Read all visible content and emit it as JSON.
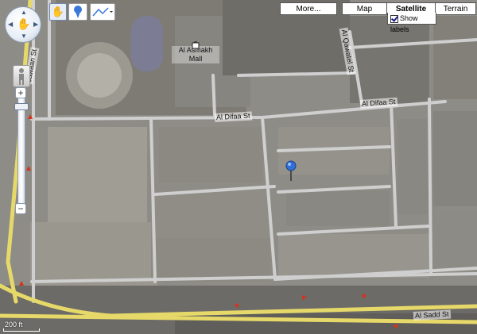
{
  "map": {
    "view": "Satellite",
    "type_buttons": {
      "more": "More...",
      "map": "Map",
      "satellite": "Satellite",
      "terrain": "Terrain"
    },
    "show_labels": {
      "label": "Show labels",
      "checked": true
    },
    "street_labels": {
      "jawaan": "Jawaan St",
      "al_difaa_1": "Al Difaa St",
      "al_difaa_2": "Al Difaa St",
      "al_qawatel": "Al Qawatel St",
      "al_sadd": "Al Sadd St"
    },
    "poi": {
      "name_line1": "Al Asmakh",
      "name_line2": "Mall",
      "icon": "shopping-bag-icon"
    },
    "marker": {
      "icon": "map-pin-icon",
      "color": "#2f6fd6"
    },
    "scale": {
      "label": "200 ft"
    },
    "tools": {
      "hand": "hand-icon",
      "pin": "place-marker-icon",
      "line": "draw-line-icon"
    },
    "controls": {
      "pan": "pan-control-icon",
      "street_view": "pegman-icon",
      "zoom_in": "+",
      "zoom_out": "−"
    }
  }
}
